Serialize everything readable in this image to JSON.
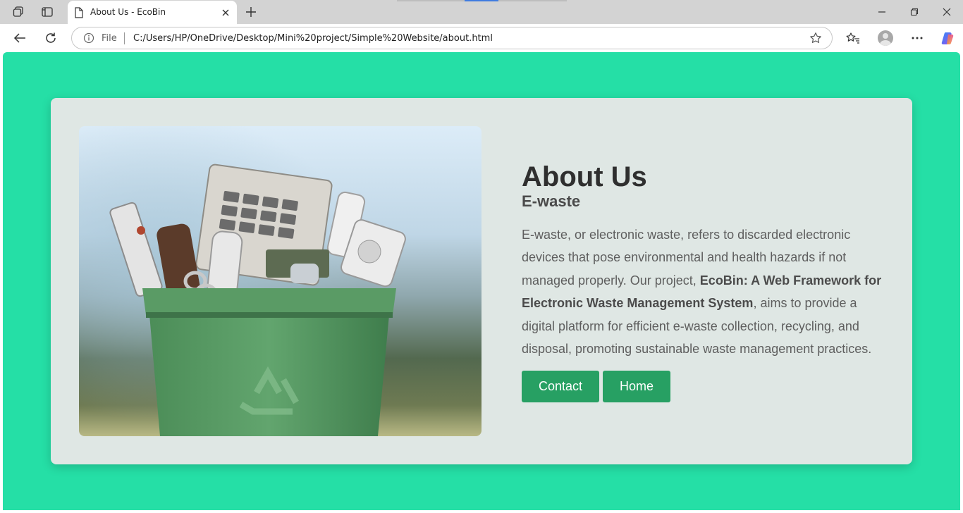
{
  "browser": {
    "tab_title": "About Us - EcoBin",
    "address_scheme": "File",
    "url": "C:/Users/HP/OneDrive/Desktop/Mini%20project/Simple%20Website/about.html"
  },
  "page": {
    "heading": "About Us",
    "subheading": "E-waste",
    "para_part1": "E-waste, or electronic waste, refers to discarded electronic devices that pose environmental and health hazards if not managed properly. Our project, ",
    "para_bold": "EcoBin: A Web Framework for Electronic Waste Management System",
    "para_part2": ", aims to provide a digital platform for efficient e-waste collection, recycling, and disposal, promoting sustainable waste management practices.",
    "buttons": {
      "contact": "Contact",
      "home": "Home"
    }
  },
  "colors": {
    "page_background": "#25dfa6",
    "card_background": "#dfe7e4",
    "button": "#27a063"
  },
  "icons": {
    "workspaces": "workspaces-icon",
    "tab_actions": "tab-actions-icon",
    "document": "document-icon",
    "close": "close-icon",
    "new_tab": "plus-icon",
    "minimize": "minimize-icon",
    "restore": "restore-icon",
    "back": "back-arrow-icon",
    "refresh": "refresh-icon",
    "info": "info-icon",
    "favorite": "star-icon",
    "favorites": "favorites-icon",
    "more": "more-icon",
    "copilot": "copilot-icon",
    "recycle": "recycle-icon"
  }
}
